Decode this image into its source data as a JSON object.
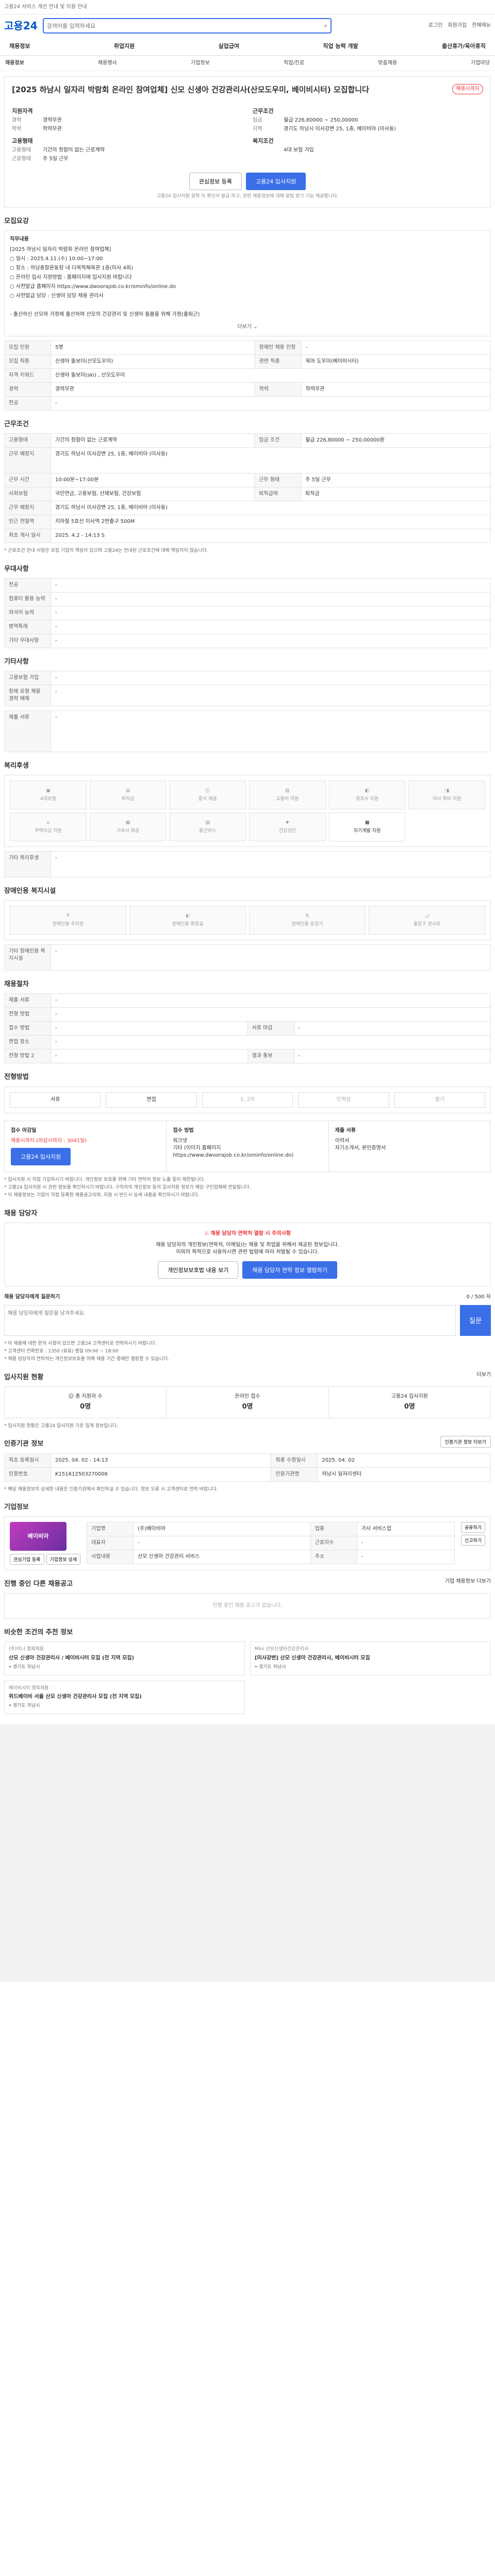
{
  "top_banner": "고용24 서비스 개선 안내 및 이용 안내",
  "header": {
    "logo": "고용24",
    "search_placeholder": "검색어를 입력하세요",
    "top_links": [
      "로그인",
      "회원가입",
      "전체메뉴"
    ]
  },
  "gnb": [
    "채용정보",
    "취업지원",
    "실업급여",
    "직업 능력 개발",
    "출산휴가/육아휴직"
  ],
  "gnb_sub": [
    "채용정보",
    "채용행사",
    "기업정보",
    "직업/진로",
    "맞춤채용",
    "기업마당"
  ],
  "job": {
    "title": "[2025 하남시 일자리 박람회 온라인 참여업체] 신모 신생아 건강관리사(산모도우미, 베이비시터) 모집합니다",
    "badge": "채용시까지",
    "left_title": "지원자격",
    "left": [
      {
        "k": "경력",
        "v": "경력무관"
      },
      {
        "k": "학력",
        "v": "학력무관"
      }
    ],
    "left_title2": "고용형태",
    "left2": [
      {
        "k": "고용형태",
        "v": "기간의 정함이 없는 근로계약"
      },
      {
        "k": "근로형태",
        "v": "주 5일 근무"
      }
    ],
    "right_title": "근무조건",
    "right": [
      {
        "k": "임금",
        "v": "월급 226,80000 ~ 250,00000"
      },
      {
        "k": "지역",
        "v": "경기도 하남시 미사강변 25, 1층, 베이비아 (미사동)"
      }
    ],
    "right_title2": "복지조건",
    "right2": [
      {
        "k": "",
        "v": "4대 보험 가입"
      }
    ],
    "btn_save": "관심정보 등록",
    "btn_apply": "고용24 입사지원",
    "note": "고용24 입사지원 광학 이 확인서 발급 하고, 관련 채용정보에 대해 알림 받기 기능 제공합니다."
  },
  "recruit": {
    "section": "모집요강",
    "desc_title": "직무내용",
    "desc": "[2025 하남시 일자리 박람회 온라인 참여업체]\n○ 일시 : 2025.4.11.(수) 10:00~17:00\n○ 장소 : 하남종합운동장 내 다목적체육관 1층(미사 4회)\n○ 온라인 입사 지원방법 : 홈페이지에 입사지원 바랍니다\n○ 사전발급 홈페이지 https://www.dwoorajob.co.kr/ominfo/online.do\n○ 사전발급 담당 : 신생아 담당 채용 관리사\n\n- 출산하신 산모와 가정에 출산하여 산모의 건강관리 및 신생아 돌봄을 위해 가정(출퇴근)",
    "more": "더보기",
    "rows": [
      {
        "k": "모집 인원",
        "v": "5명",
        "k2": "장애인 채용 인정",
        "v2": "-"
      },
      {
        "k": "모집 직종",
        "v": "신생아 돌보미(산모도우미)",
        "k2": "관련 직종",
        "v2": "육아 도우미(베이비시터)"
      },
      {
        "k": "자격 키워드",
        "v": "신생아 돌보미(ski) , 산모도우미",
        "k2": "",
        "v2": ""
      },
      {
        "k": "경력",
        "v": "경력무관",
        "k2": "학력",
        "v2": "학력무관"
      },
      {
        "k": "전공",
        "v": "-",
        "k2": "",
        "v2": ""
      }
    ]
  },
  "work": {
    "section": "근무조건",
    "rows": [
      {
        "k": "고용형태",
        "v": "기간의 정함이 없는 근로계약",
        "k2": "임금 조건",
        "v2": "월급 226,80000 ~ 250,00000원"
      },
      {
        "k": "근무 예정지",
        "v": "경기도 하남시 미사강변 25, 1층, 베이비아 (미사동)",
        "k2": "",
        "v2": ""
      },
      {
        "k": "근무 시간",
        "v": "10:00분~17:00분",
        "k2": "근무 형태",
        "v2": "주 5일 근무"
      },
      {
        "k": "사회보험",
        "v": "국민연금, 고용보험, 산재보험, 건강보험",
        "k2": "퇴직급여",
        "v2": "퇴직금"
      },
      {
        "k": "근무 예정지",
        "v": "경기도 하남시 미사강변 25, 1층, 베이비아 (미사동)",
        "k2": "",
        "v2": ""
      },
      {
        "k": "인근 전철역",
        "v": "지하철 5호선 미사역 2번출구 500M",
        "k2": "",
        "v2": ""
      },
      {
        "k": "최초 게시 일시",
        "v": "2025. 4.2 - 14:13 S",
        "k2": "",
        "v2": ""
      }
    ],
    "note": "* 근로조건 안내 사항은 모집 기업의 책임이 있으며 고용24는 안내된 근로조건에 대해 책임지지 않습니다."
  },
  "extra": {
    "section": "우대사항",
    "rows": [
      {
        "k": "전공",
        "v": "-"
      },
      {
        "k": "컴퓨터 활용 능력",
        "v": "-"
      },
      {
        "k": "외국어 능력",
        "v": "-"
      },
      {
        "k": "병역특례",
        "v": "-"
      },
      {
        "k": "기타 우대사항",
        "v": "-"
      }
    ]
  },
  "etc": {
    "section": "기타사항",
    "rows": [
      {
        "k": "고용보험 가입",
        "v": "-"
      },
      {
        "k": "장애 유형 채용 경력 배제",
        "v": "-"
      }
    ]
  },
  "etc2": {
    "rows": [
      {
        "k": "제출 서류",
        "v": "-"
      }
    ]
  },
  "welfare": {
    "section": "복리후생",
    "tiles": [
      {
        "label": "4대보험",
        "on": false
      },
      {
        "label": "퇴직금",
        "on": false
      },
      {
        "label": "중식 제공",
        "on": false
      },
      {
        "label": "교통비 지원",
        "on": false
      },
      {
        "label": "경조사 지원",
        "on": false
      },
      {
        "label": "자녀 학비 지원",
        "on": false
      },
      {
        "label": "주택자금 지원",
        "on": false
      },
      {
        "label": "기숙사 제공",
        "on": false
      },
      {
        "label": "통근버스",
        "on": false
      },
      {
        "label": "건강검진",
        "on": false
      },
      {
        "label": "자기계발 지원",
        "on": true
      }
    ],
    "etc_label": "기타 복리후생",
    "etc_value": "-"
  },
  "disability": {
    "section": "장애인용 복지시설",
    "tiles": [
      {
        "label": "장애인용 주차장"
      },
      {
        "label": "장애인용 화장실"
      },
      {
        "label": "장애인용 승강기"
      },
      {
        "label": "출입구 경사로"
      }
    ],
    "etc_label": "기타 장애인용 복지시설",
    "etc_value": "-"
  },
  "process": {
    "section": "채용절차",
    "rows": [
      {
        "k": "제출 서류",
        "v": "-"
      },
      {
        "k": "전형 방법",
        "v": "-",
        "k2": "",
        "v2": ""
      },
      {
        "k": "접수 방법",
        "v": "-",
        "k2": "서류 마감",
        "v2": "-"
      },
      {
        "k": "면접 장소",
        "v": "-",
        "k2": "",
        "v2": ""
      },
      {
        "k": "전형 방법 2",
        "v": "-",
        "k2": "결과 통보",
        "v2": "-"
      }
    ]
  },
  "steps": {
    "section": "전형방법",
    "items": [
      {
        "label": "서류",
        "on": true
      },
      {
        "label": "면접",
        "on": true
      },
      {
        "label": "1, 2차",
        "on": false
      },
      {
        "label": "인적성",
        "on": false
      },
      {
        "label": "필기",
        "on": false
      }
    ]
  },
  "apply": {
    "c1_title": "접수 마감일",
    "c1_value": "채용시까지 (마감시까지 : 3041일)",
    "c1_btn": "고용24 입사지원",
    "c2_title": "접수 방법",
    "c2_value": "워크넷\n기타 (이미지 홈페이지 https://www.dwoorajob.co.kr/ominfo/online.do)",
    "c3_title": "제출 서류",
    "c3_value": "이력서\n자기소개서, 본인증명서",
    "bullets": "* 입사지원 시 직접 기입하시기 바랍니다. 개인정보 보호를 위해 기타 연락처 정보 노출 등이 제한됩니다.\n* 고용24 입사지원 시 관련 정보를 확인하시기 바랍니다. 구직자의 개인정보 등의 입사지원 정보가 해당 구인업체에 전달됩니다.\n* 이 채용정보는 기업이 직접 등록한 채용공고이며, 지원 시 반드시 상세 내용을 확인하시기 바랍니다."
  },
  "contact": {
    "section": "채용 담당자",
    "notice_title": "채용 담당자 연락처 열람 시 주의사항",
    "notice_body": "채용 담당자의 개인정보(연락처, 이메일)는 채용 및 취업을 위해서 제공된 정보입니다.\n이외의 목적으로 사용하시면 관련 법령에 따라 처벌될 수 있습니다.",
    "btn1": "개인정보보호법 내용 보기",
    "btn2": "채용 담당자 연락 정보 열람하기",
    "qa_title": "채용 담당자에게 질문하기",
    "qa_count": "0 / 500 자",
    "qa_placeholder": "채용 담당자에게 질문을 남겨주세요.",
    "qa_btn": "질문",
    "notes": "* 이 채용에 대한 문의 사항이 있으면 고용24 고객센터로 연락하시기 바랍니다.\n* 고객센터 전화번호 : 1350 (유료) 평일 09:00 ~ 18:00\n* 채용 담당자의 연락처는 개인정보보호를 위해 채용 기간 중에만 열람할 수 있습니다."
  },
  "stats": {
    "section": "입사지원 현황",
    "more": "더보기",
    "items": [
      {
        "label": "총 지원자 수",
        "value": "0명"
      },
      {
        "label": "온라인 접수",
        "value": "0명"
      },
      {
        "label": "고용24 입사지원",
        "value": "0명"
      }
    ],
    "note": "* 입사지원 현황은 고용24 입사지원 기준 집계 정보입니다."
  },
  "manage": {
    "section": "인증기관 정보",
    "btn": "인증기관 정보 더보기",
    "rows": [
      {
        "k": "최초 등록일시",
        "v": "2025. 04. 02 - 14:13",
        "k2": "최종 수정일시",
        "v2": "2025. 04. 02"
      },
      {
        "k": "인증번호",
        "v": "K151612503270006",
        "k2": "인증기관명",
        "v2": "하남시 일자리센터"
      }
    ],
    "note": "* 해당 채용정보의 상세한 내용은 인증기관에서 확인하실 수 있습니다. 정보 오류 시 고객센터로 연락 바랍니다."
  },
  "company": {
    "section": "기업정보",
    "logo_text": "베이비아",
    "btn1": "관심기업 등록",
    "btn2": "기업정보 상세",
    "btn3": "공유하기",
    "btn4": "신고하기",
    "rows": [
      {
        "k": "기업명",
        "v": "(주)베이비아",
        "k2": "업종",
        "v2": "가사 서비스업"
      },
      {
        "k": "대표자",
        "v": "-",
        "k2": "근로자수",
        "v2": "-"
      },
      {
        "k": "사업내용",
        "v": "산모 신생아 건강관리 서비스",
        "k2": "주소",
        "v2": "-"
      }
    ]
  },
  "ongoing": {
    "section": "진행 중인 다른 채용공고",
    "more": "기업 채용정보 더보기",
    "empty": "진행 중인 채용 공고가 없습니다."
  },
  "related": {
    "section": "비슷한 조건의 추천 정보",
    "items": [
      {
        "co": "(주)미니 행복채용",
        "title": "산모 신생아 건강관리사 / 베이비시터 모집 (전 지역 모집)",
        "loc": "경기도 하남시"
      },
      {
        "co": "Mini 산모신생아건강관리사",
        "title": "[미사강변] 산모 신생아 건강관리사, 베이비시터 모집",
        "loc": "경기도 하남시"
      },
      {
        "co": "베이비시터 행복채용",
        "title": "위드베이비 서울 산모 신생아 건강관리사 모집 (전 지역 모집)",
        "loc": "경기도 하남시"
      }
    ]
  }
}
